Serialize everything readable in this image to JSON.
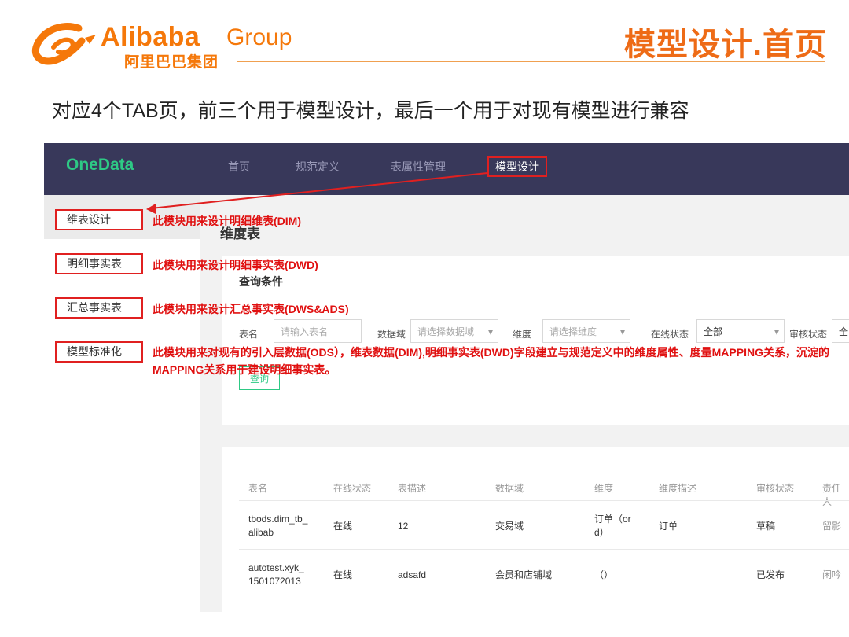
{
  "header": {
    "brand_en": "Alibaba",
    "brand_group": "Group",
    "brand_cn": "阿里巴巴集团",
    "slide_title": "模型设计.首页",
    "subtitle": "对应4个TAB页，前三个用于模型设计，最后一个用于对现有模型进行兼容"
  },
  "colors": {
    "brand": "#f5780a",
    "topbar": "#38385a",
    "accent_green": "#2ec985",
    "annotation_red": "#e01010"
  },
  "app": {
    "logo": "OneData",
    "nav": [
      "首页",
      "规范定义",
      "表属性管理",
      "模型设计"
    ],
    "nav_active_index": 3
  },
  "sidebar": {
    "items": [
      "维表设计",
      "明细事实表",
      "汇总事实表",
      "模型标准化"
    ]
  },
  "annotations": [
    "此模块用来设计明细维表(DIM)",
    "此模块用来设计明细事实表(DWD)",
    "此模块用来设计汇总事实表(DWS&ADS)",
    "此模块用来对现有的引入层数据(ODS），维表数据(DIM),明细事实表(DWD)字段建立与规范定义中的维度属性、度量MAPPING关系，沉淀的MAPPING关系用于建设明细事实表。"
  ],
  "main": {
    "page_title": "维度表",
    "query": {
      "title": "查询条件",
      "table_name_label": "表名",
      "table_name_placeholder": "请输入表名",
      "domain_label": "数据域",
      "domain_placeholder": "请选择数据域",
      "dimension_label": "维度",
      "dimension_placeholder": "请选择维度",
      "online_label": "在线状态",
      "online_value": "全部",
      "audit_label": "审核状态",
      "audit_value": "全",
      "button": "查询"
    },
    "table": {
      "headers": [
        "表名",
        "在线状态",
        "表描述",
        "数据域",
        "维度",
        "维度描述",
        "审核状态",
        "责任人"
      ],
      "rows": [
        [
          "tbods.dim_tb_\nalibab",
          "在线",
          "12",
          "交易域",
          "订单（or\nd）",
          "订单",
          "草稿",
          "留影"
        ],
        [
          "autotest.xyk_\n1501072013",
          "在线",
          "adsafd",
          "会员和店铺域",
          "（）",
          "",
          "已发布",
          "闲吟"
        ]
      ]
    }
  }
}
